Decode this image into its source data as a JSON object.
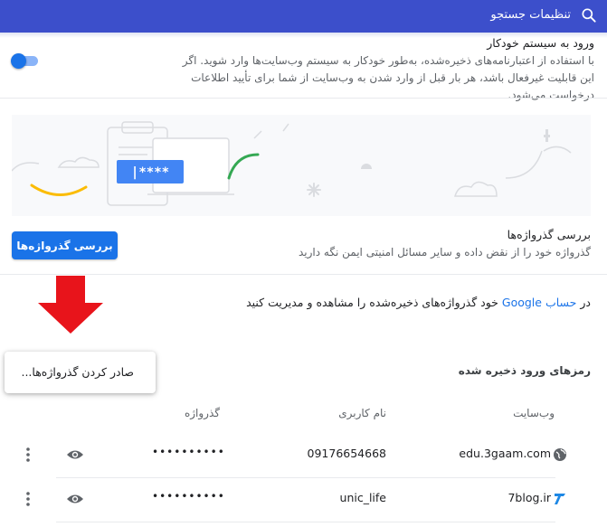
{
  "header": {
    "search_label": "تنظیمات جستجو",
    "search_icon": "search-icon",
    "background_color": "#3c4fcb"
  },
  "auto_signin": {
    "title": "ورود به سیستم خودکار",
    "description": "با استفاده از اعتبارنامه‌های ذخیره‌شده، به‌طور خودکار به سیستم وب‌سایت‌ها وارد شوید. اگر این قابلیت غیرفعال باشد، هر بار قبل از وارد شدن به وب‌سایت از شما برای تأیید اطلاعات درخواست می‌شود.",
    "toggle_on": true
  },
  "illustration": {
    "password_mask": "****|"
  },
  "checkup": {
    "title": "بررسی گذرواژه‌ها",
    "description": "گذرواژه خود را از نقض داده و سایر مسائل امنیتی ایمن نگه دارید",
    "button_label": "بررسی گذرواژه‌ها"
  },
  "google_account": {
    "prefix": "در ",
    "link_text": "حساب Google",
    "suffix": " خود گذرواژه‌های ذخیره‌شده را مشاهده و مدیریت کنید"
  },
  "export_menu": {
    "item_label": "صادر کردن گذرواژه‌ها..."
  },
  "saved": {
    "heading": "رمزهای ورود ذخیره شده",
    "columns": {
      "website": "وب‌سایت",
      "username": "نام کاربری",
      "password": "گذرواژه"
    },
    "rows": [
      {
        "site": "edu.3gaam.com",
        "username": "09176654668",
        "password": "••••••••••",
        "favicon": "globe-icon"
      },
      {
        "site": "7blog.ir",
        "username": "unic_life",
        "password": "••••••••••",
        "favicon": "7blog-favicon"
      }
    ]
  },
  "colors": {
    "accent": "#1a73e8",
    "arrow_red": "#e8141b"
  }
}
